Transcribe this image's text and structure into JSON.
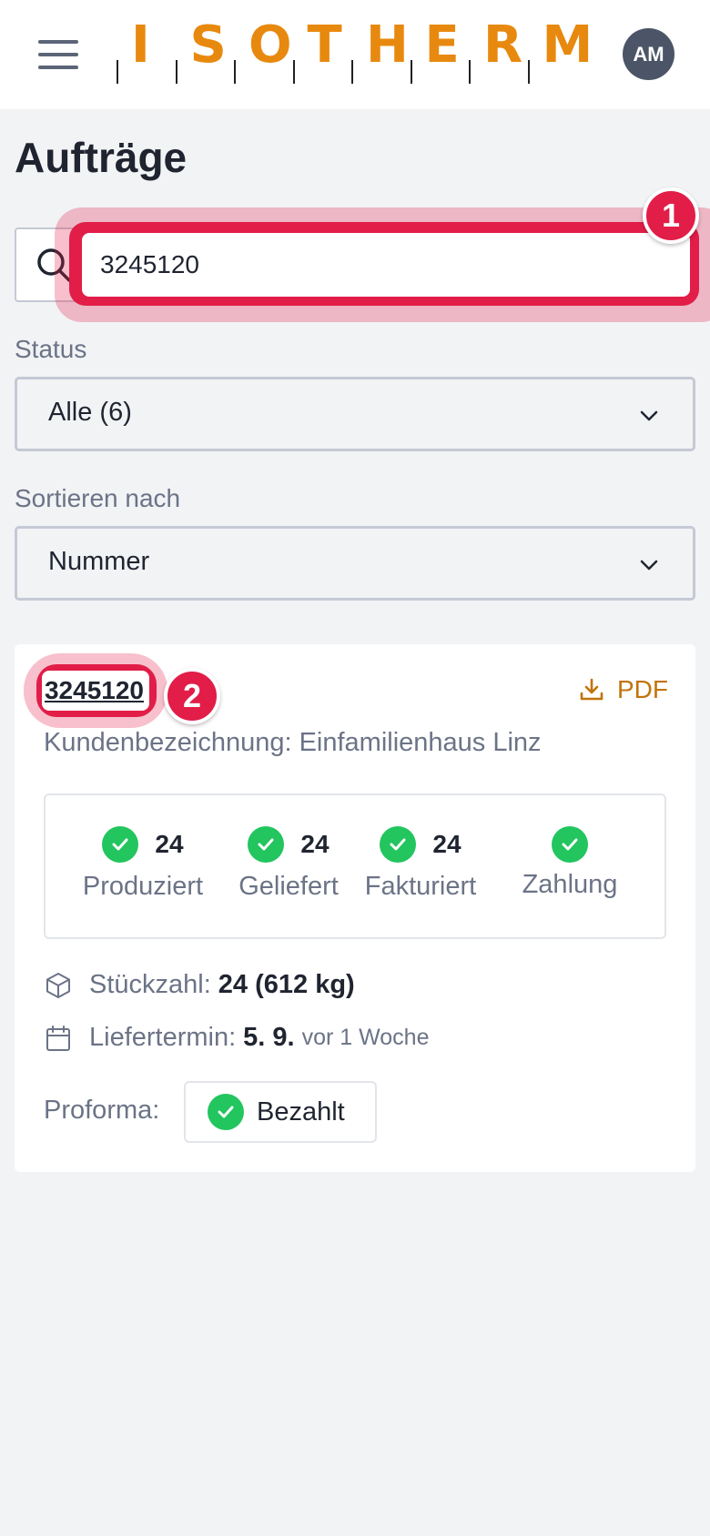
{
  "header": {
    "logo_letters": [
      "I",
      "S",
      "O",
      "T",
      "H",
      "E",
      "R",
      "M"
    ],
    "avatar_initials": "AM"
  },
  "page": {
    "title": "Aufträge"
  },
  "search": {
    "value": "3245120",
    "placeholder": ""
  },
  "annotations": {
    "badge_1": "1",
    "badge_2": "2"
  },
  "filters": {
    "status_label": "Status",
    "status_value": "Alle (6)",
    "sort_label": "Sortieren nach",
    "sort_value": "Nummer"
  },
  "order": {
    "number": "3245120",
    "pdf_label": "PDF",
    "customer": "Kundenbezeichnung: Einfamilienhaus Linz",
    "statuses": [
      {
        "count": "24",
        "label": "Produziert"
      },
      {
        "count": "24",
        "label": "Geliefert"
      },
      {
        "count": "24",
        "label": "Fakturiert"
      },
      {
        "count": "",
        "label": "Zahlung"
      }
    ],
    "quantity_label": "Stückzahl:",
    "quantity_value": "24 (612 kg)",
    "delivery_label": "Liefertermin:",
    "delivery_value": "5. 9.",
    "delivery_relative": "vor 1 Woche",
    "proforma_label": "Proforma:",
    "proforma_status": "Bezahlt"
  },
  "colors": {
    "accent": "#e8890f",
    "highlight": "#e11d48",
    "success": "#22c55e",
    "pdf_link": "#c2730b"
  }
}
